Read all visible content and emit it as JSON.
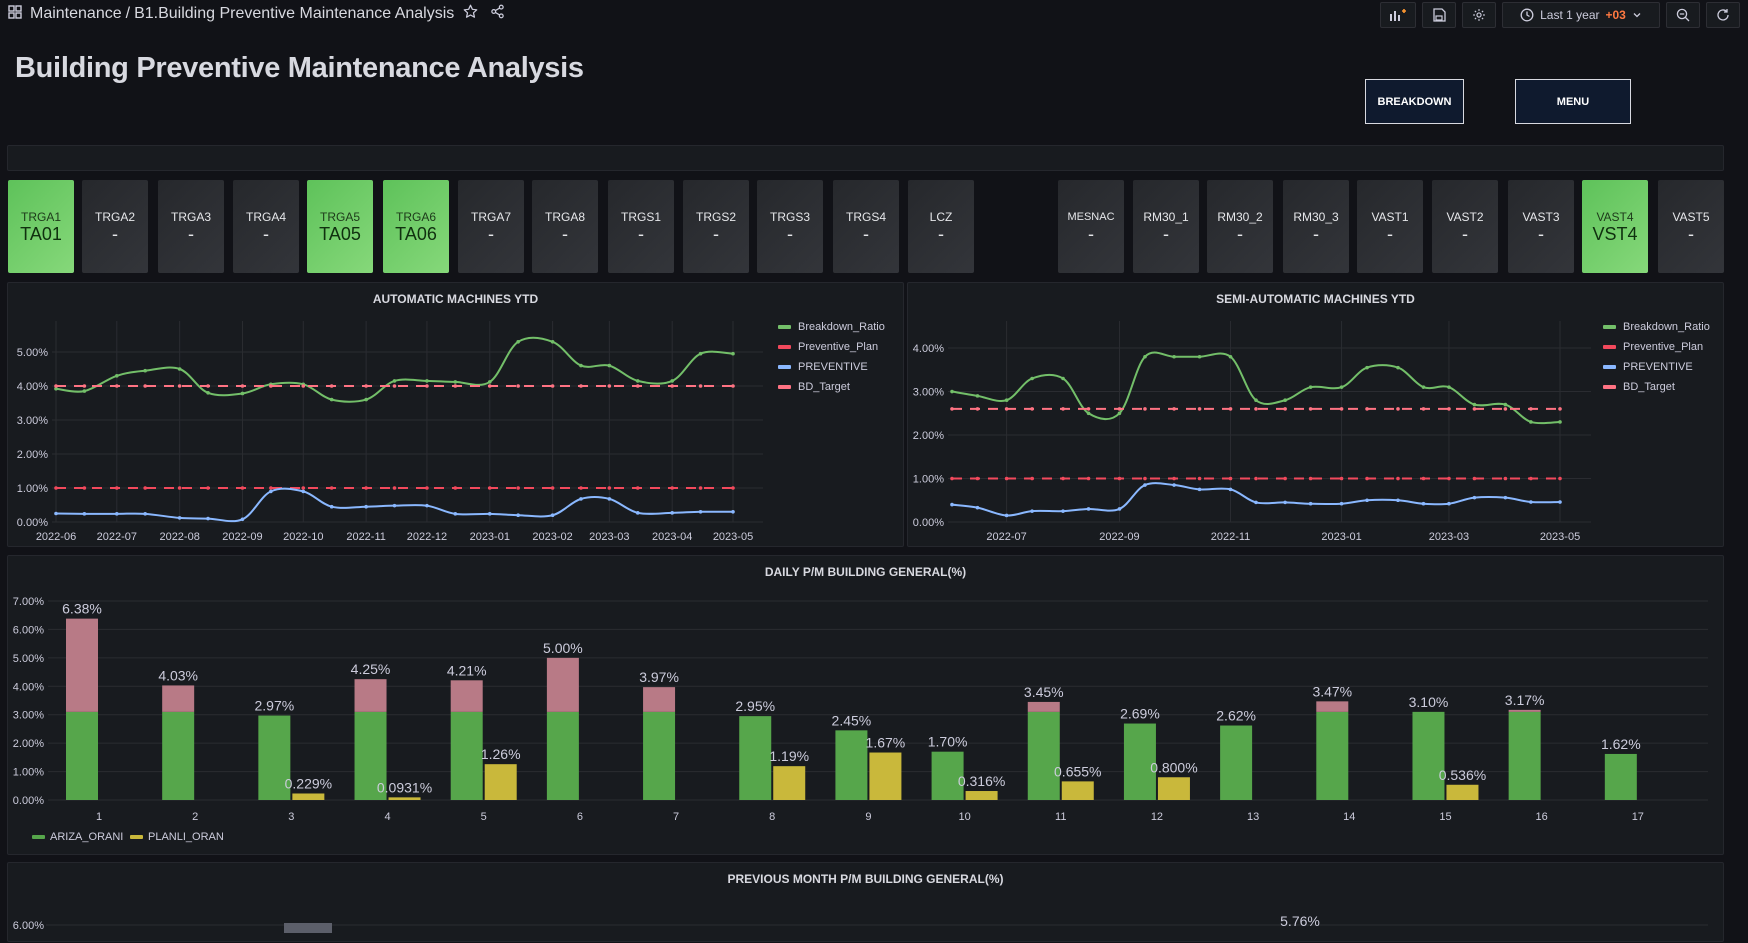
{
  "header": {
    "folder": "Maintenance",
    "separator": "/",
    "dashboard": "B1.Building Preventive Maintenance Analysis",
    "time_range": "Last 1 year",
    "timezone": "+03"
  },
  "page_title": "Building Preventive Maintenance Analysis",
  "nav": {
    "breakdown": "BREAKDOWN",
    "menu": "MENU"
  },
  "tiles": [
    {
      "label": "TRGA1",
      "value": "TA01",
      "status": "ok"
    },
    {
      "label": "TRGA2",
      "value": "-",
      "status": "off"
    },
    {
      "label": "TRGA3",
      "value": "-",
      "status": "off"
    },
    {
      "label": "TRGA4",
      "value": "-",
      "status": "off"
    },
    {
      "label": "TRGA5",
      "value": "TA05",
      "status": "ok"
    },
    {
      "label": "TRGA6",
      "value": "TA06",
      "status": "ok"
    },
    {
      "label": "TRGA7",
      "value": "-",
      "status": "off"
    },
    {
      "label": "TRGA8",
      "value": "-",
      "status": "off"
    },
    {
      "label": "TRGS1",
      "value": "-",
      "status": "off"
    },
    {
      "label": "TRGS2",
      "value": "-",
      "status": "off"
    },
    {
      "label": "TRGS3",
      "value": "-",
      "status": "off"
    },
    {
      "label": "TRGS4",
      "value": "-",
      "status": "off"
    },
    {
      "label": "LCZ",
      "value": "-",
      "status": "off"
    },
    {
      "label": "MESNAC",
      "value": "-",
      "status": "off"
    },
    {
      "label": "RM30_1",
      "value": "-",
      "status": "off"
    },
    {
      "label": "RM30_2",
      "value": "-",
      "status": "off"
    },
    {
      "label": "RM30_3",
      "value": "-",
      "status": "off"
    },
    {
      "label": "VAST1",
      "value": "-",
      "status": "off"
    },
    {
      "label": "VAST2",
      "value": "-",
      "status": "off"
    },
    {
      "label": "VAST3",
      "value": "-",
      "status": "off"
    },
    {
      "label": "VAST4",
      "value": "VST4",
      "status": "ok"
    },
    {
      "label": "VAST5",
      "value": "-",
      "status": "off"
    }
  ],
  "colors": {
    "breakdown_ratio": "#73bf69",
    "preventive_plan": "#f2495c",
    "preventive": "#8ab8ff",
    "bd_target": "#ff7383",
    "ariza": "#56a64b",
    "planli": "#c9b83b",
    "excess": "#b87a86"
  },
  "chart_data": [
    {
      "type": "line",
      "title": "AUTOMATIC MACHINES YTD",
      "x": [
        "2022-06-01",
        "2022-06-15",
        "2022-07-01",
        "2022-07-15",
        "2022-08-01",
        "2022-08-15",
        "2022-09-01",
        "2022-09-15",
        "2022-10-01",
        "2022-10-15",
        "2022-11-01",
        "2022-11-15",
        "2022-12-01",
        "2022-12-15",
        "2023-01-01",
        "2023-01-15",
        "2023-02-01",
        "2023-02-15",
        "2023-03-01",
        "2023-03-15",
        "2023-04-01",
        "2023-04-15",
        "2023-05-01"
      ],
      "x_ticks": [
        "2022-06",
        "2022-07",
        "2022-08",
        "2022-09",
        "2022-10",
        "2022-11",
        "2022-12",
        "2023-01",
        "2023-02",
        "2023-03",
        "2023-04",
        "2023-05"
      ],
      "ylim": [
        0,
        5.5
      ],
      "y_ticks": [
        "0.00%",
        "1.00%",
        "2.00%",
        "3.00%",
        "4.00%",
        "5.00%"
      ],
      "grid": true,
      "legend_position": "right",
      "series": [
        {
          "name": "Breakdown_Ratio",
          "style": "solid",
          "values": [
            3.92,
            3.85,
            4.3,
            4.45,
            4.5,
            3.8,
            3.78,
            4.05,
            4.05,
            3.6,
            3.6,
            4.15,
            4.15,
            4.12,
            4.12,
            5.3,
            5.3,
            4.6,
            4.6,
            4.15,
            4.15,
            4.95,
            4.95
          ]
        },
        {
          "name": "Preventive_Plan",
          "style": "dashed",
          "values": [
            1,
            1,
            1,
            1,
            1,
            1,
            1,
            1,
            1,
            1,
            1,
            1,
            1,
            1,
            1,
            1,
            1,
            1,
            1,
            1,
            1,
            1,
            1
          ]
        },
        {
          "name": "PREVENTIVE",
          "style": "solid",
          "values": [
            0.25,
            0.24,
            0.24,
            0.24,
            0.12,
            0.1,
            0.08,
            0.9,
            0.9,
            0.45,
            0.45,
            0.48,
            0.48,
            0.24,
            0.24,
            0.2,
            0.2,
            0.68,
            0.68,
            0.27,
            0.27,
            0.3,
            0.3
          ]
        },
        {
          "name": "BD_Target",
          "style": "dashed",
          "values": [
            4,
            4,
            4,
            4,
            4,
            4,
            4,
            4,
            4,
            4,
            4,
            4,
            4,
            4,
            4,
            4,
            4,
            4,
            4,
            4,
            4,
            4,
            4
          ]
        }
      ]
    },
    {
      "type": "line",
      "title": "SEMI-AUTOMATIC MACHINES YTD",
      "x": [
        "2022-06-01",
        "2022-06-15",
        "2022-07-01",
        "2022-07-15",
        "2022-08-01",
        "2022-08-15",
        "2022-09-01",
        "2022-09-15",
        "2022-10-01",
        "2022-10-15",
        "2022-11-01",
        "2022-11-15",
        "2022-12-01",
        "2022-12-15",
        "2023-01-01",
        "2023-01-15",
        "2023-02-01",
        "2023-02-15",
        "2023-03-01",
        "2023-03-15",
        "2023-04-01",
        "2023-04-15",
        "2023-05-01"
      ],
      "x_ticks": [
        "2022-07",
        "2022-09",
        "2022-11",
        "2023-01",
        "2023-03",
        "2023-05"
      ],
      "ylim": [
        0,
        4.3
      ],
      "y_ticks": [
        "0.00%",
        "1.00%",
        "2.00%",
        "3.00%",
        "4.00%"
      ],
      "grid": true,
      "legend_position": "right",
      "series": [
        {
          "name": "Breakdown_Ratio",
          "style": "solid",
          "values": [
            3.0,
            2.9,
            2.8,
            3.3,
            3.3,
            2.5,
            2.5,
            3.8,
            3.8,
            3.8,
            3.8,
            2.8,
            2.8,
            3.1,
            3.1,
            3.55,
            3.55,
            3.1,
            3.1,
            2.7,
            2.7,
            2.3,
            2.3
          ]
        },
        {
          "name": "Preventive_Plan",
          "style": "dashed",
          "values": [
            1,
            1,
            1,
            1,
            1,
            1,
            1,
            1,
            1,
            1,
            1,
            1,
            1,
            1,
            1,
            1,
            1,
            1,
            1,
            1,
            1,
            1,
            1
          ]
        },
        {
          "name": "PREVENTIVE",
          "style": "solid",
          "values": [
            0.4,
            0.33,
            0.15,
            0.25,
            0.25,
            0.3,
            0.3,
            0.85,
            0.85,
            0.75,
            0.75,
            0.45,
            0.45,
            0.42,
            0.42,
            0.5,
            0.5,
            0.42,
            0.42,
            0.56,
            0.56,
            0.46,
            0.46
          ]
        },
        {
          "name": "BD_Target",
          "style": "dashed",
          "values": [
            2.6,
            2.6,
            2.6,
            2.6,
            2.6,
            2.6,
            2.6,
            2.6,
            2.6,
            2.6,
            2.6,
            2.6,
            2.6,
            2.6,
            2.6,
            2.6,
            2.6,
            2.6,
            2.6,
            2.6,
            2.6,
            2.6,
            2.6
          ]
        }
      ]
    },
    {
      "type": "bar",
      "title": "DAILY P/M BUILDING GENERAL(%)",
      "categories": [
        "1",
        "2",
        "3",
        "4",
        "5",
        "6",
        "7",
        "8",
        "9",
        "10",
        "11",
        "12",
        "13",
        "14",
        "15",
        "16",
        "17"
      ],
      "ylim": [
        0,
        7
      ],
      "y_ticks": [
        "0.00%",
        "1.00%",
        "2.00%",
        "3.00%",
        "4.00%",
        "5.00%",
        "6.00%",
        "7.00%"
      ],
      "grid": true,
      "legend_position": "bottom-left",
      "series": [
        {
          "name": "ARIZA_ORANI",
          "values": [
            6.38,
            4.03,
            2.97,
            4.25,
            4.21,
            5.0,
            3.97,
            2.95,
            2.45,
            1.7,
            3.45,
            2.69,
            2.62,
            3.47,
            3.1,
            3.17,
            1.62
          ],
          "labels": [
            "6.38%",
            "4.03%",
            "2.97%",
            "4.25%",
            "4.21%",
            "5.00%",
            "3.97%",
            "2.95%",
            "2.45%",
            "1.70%",
            "3.45%",
            "2.69%",
            "2.62%",
            "3.47%",
            "3.10%",
            "3.17%",
            "1.62%"
          ]
        },
        {
          "name": "PLANLI_ORAN",
          "values": [
            null,
            null,
            0.229,
            0.0931,
            1.26,
            null,
            null,
            1.19,
            1.67,
            0.316,
            0.655,
            0.8,
            null,
            null,
            0.536,
            null,
            null
          ],
          "labels": [
            null,
            null,
            "0.229%",
            "0.0931%",
            "1.26%",
            null,
            null,
            "1.19%",
            "1.67%",
            "0.316%",
            "0.655%",
            "0.800%",
            null,
            null,
            "0.536%",
            null,
            null
          ]
        }
      ],
      "threshold": 3.1
    }
  ],
  "prev_month": {
    "title": "PREVIOUS MONTH P/M BUILDING GENERAL(%)",
    "y_top_label": "6.00%",
    "visible_value_label": "5.76%"
  }
}
